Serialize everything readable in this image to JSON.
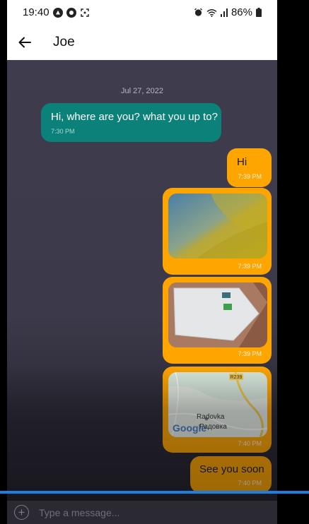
{
  "status_bar": {
    "time": "19:40",
    "battery": "86%",
    "icons": [
      "google-badge-icon",
      "location-badge-icon",
      "screenshot-icon",
      "alarm-icon",
      "wifi-icon",
      "signal-icon",
      "battery-icon"
    ]
  },
  "header": {
    "title": "Joe",
    "back_icon": "arrow-left-icon"
  },
  "chat": {
    "date_separator": "Jul 27, 2022",
    "messages": [
      {
        "direction": "incoming",
        "type": "text",
        "text": "Hi, where are you? what you up to?",
        "time": "7:30 PM"
      },
      {
        "direction": "outgoing",
        "type": "text",
        "text": "Hi",
        "time": "7:39 PM"
      },
      {
        "direction": "outgoing",
        "type": "image",
        "time": "7:39 PM"
      },
      {
        "direction": "outgoing",
        "type": "image",
        "time": "7:39 PM"
      },
      {
        "direction": "outgoing",
        "type": "map",
        "labels": [
          "R239",
          "Radovka",
          "Google",
          "Радовка"
        ],
        "time": "7:40 PM"
      },
      {
        "direction": "outgoing",
        "type": "text",
        "text": "See you soon",
        "time": "7:40 PM"
      }
    ]
  },
  "composer": {
    "placeholder": "Type a message...",
    "add_icon": "plus-circle-icon"
  },
  "colors": {
    "incoming_bubble": "#0b8179",
    "outgoing_bubble": "#ffa500",
    "chat_background": "#3e3c4d",
    "accent_line": "#1d7ee0"
  }
}
